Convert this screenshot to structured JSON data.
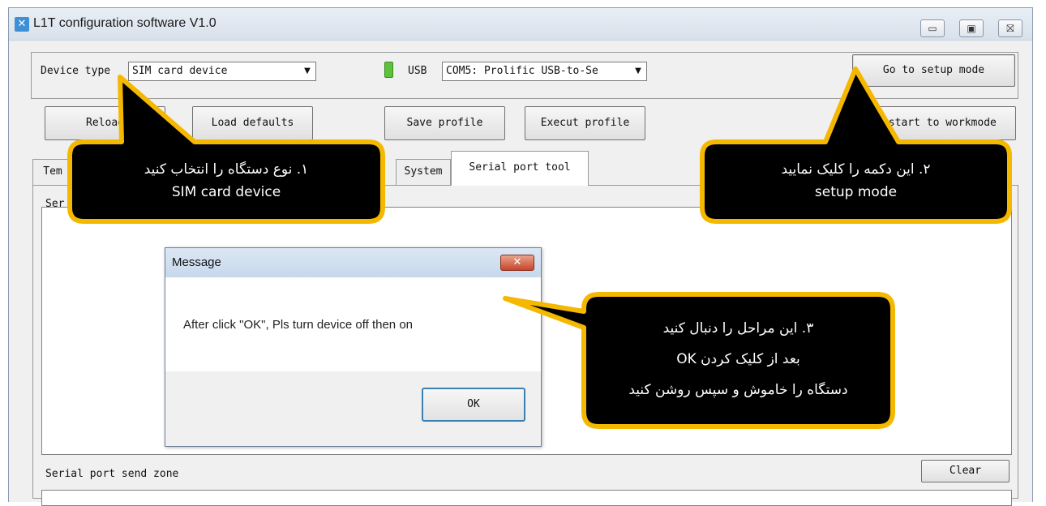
{
  "window": {
    "title": "L1T configuration software V1.0",
    "controls": {
      "minimize": "▭",
      "maximize": "▣",
      "close": "⛝"
    }
  },
  "toolbar": {
    "device_type_label": "Device type",
    "device_type_value": "SIM card device",
    "usb_label": "USB",
    "port_value": "COM5: Prolific USB-to-Se",
    "setup_mode_button": "Go to setup mode",
    "reload_button": "Reload",
    "load_defaults_button": "Load defaults",
    "save_profile_button": "Save profile",
    "execute_profile_button": "Execut profile",
    "restart_button": "Restart to workmode"
  },
  "tabs": [
    {
      "label": "Tem",
      "active": false
    },
    {
      "label": "System",
      "active": false
    },
    {
      "label": "Serial port tool",
      "active": true
    }
  ],
  "panel": {
    "receive_label": "Ser",
    "send_zone_label": "Serial port send zone",
    "clear_button": "Clear"
  },
  "dialog": {
    "title": "Message",
    "close_glyph": "✕",
    "text": "After click \"OK\", Pls turn device off then on",
    "ok_button": "OK"
  },
  "callouts": [
    {
      "lines": [
        "۱. نوع دستگاه را انتخاب کنید",
        "SIM card device"
      ]
    },
    {
      "lines": [
        "۲. این دکمه را کلیک نمایید",
        "setup mode"
      ]
    },
    {
      "lines": [
        "۳. این مراحل را دنبال کنید",
        "بعد از کلیک کردن OK",
        "دستگاه را خاموش و سپس روشن کنید"
      ]
    }
  ],
  "colors": {
    "callout_fill": "#000000",
    "callout_border": "#f5b800",
    "usb_icon": "#5cc23b"
  }
}
